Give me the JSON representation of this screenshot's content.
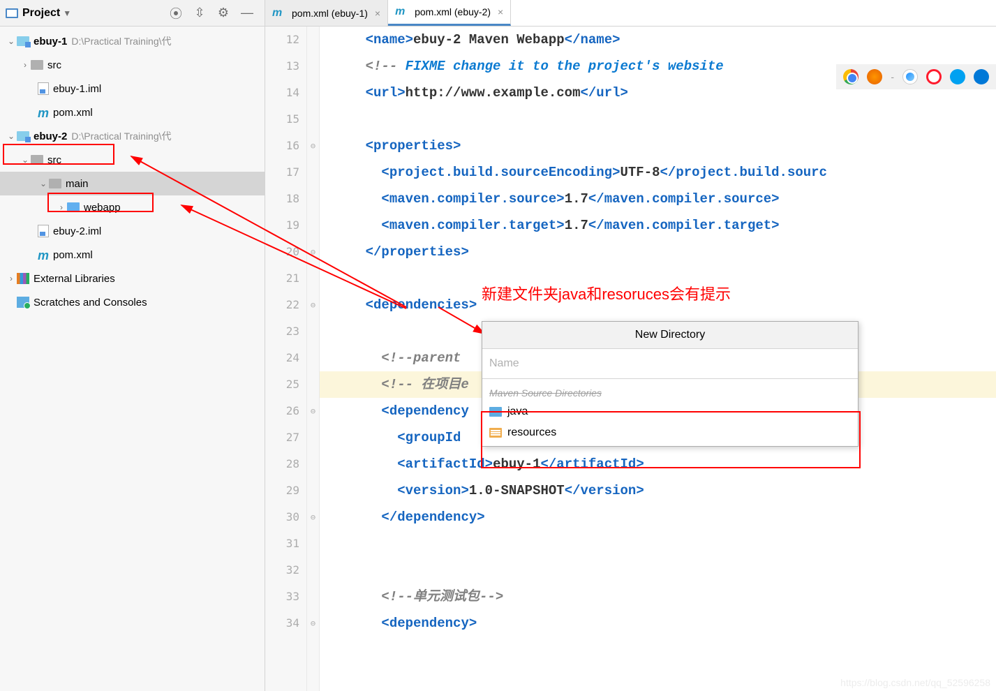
{
  "toolbar": {
    "title": "Project"
  },
  "tree": {
    "ebuy1": {
      "name": "ebuy-1",
      "path": "D:\\Practical Training\\代"
    },
    "ebuy1_src": "src",
    "ebuy1_iml": "ebuy-1.iml",
    "pom": "pom.xml",
    "ebuy2": {
      "name": "ebuy-2",
      "path": "D:\\Practical Training\\代"
    },
    "ebuy2_src": "src",
    "main": "main",
    "webapp": "webapp",
    "ebuy2_iml": "ebuy-2.iml",
    "external": "External Libraries",
    "scratches": "Scratches and Consoles"
  },
  "tabs": {
    "t1": "pom.xml (ebuy-1)",
    "t2": "pom.xml (ebuy-2)"
  },
  "code": {
    "l12": {
      "pre": "    ",
      "name_open": "name",
      "txt": "ebuy-2 Maven Webapp",
      "name_close": "name"
    },
    "l13": {
      "pre": "    ",
      "cmt_open": "<!-- ",
      "fixme": "FIXME change it to the project's website"
    },
    "l14": {
      "pre": "    ",
      "url_open": "url",
      "txt": "http://www.example.com",
      "url_close": "url"
    },
    "l16": {
      "pre": "    ",
      "prop": "properties"
    },
    "l17": {
      "pre": "      ",
      "tag": "project.build.sourceEncoding",
      "txt": "UTF-8"
    },
    "l18": {
      "pre": "      ",
      "tag": "maven.compiler.source",
      "txt": "1.7"
    },
    "l19": {
      "pre": "      ",
      "tag": "maven.compiler.target",
      "txt": "1.7"
    },
    "l20": {
      "pre": "    ",
      "prop": "properties"
    },
    "l22": {
      "pre": "    ",
      "dep": "dependencies"
    },
    "l24": {
      "pre": "      ",
      "cmt": "<!--parent"
    },
    "l25": {
      "pre": "      ",
      "cmt": "<!-- 在项目e"
    },
    "l26": {
      "pre": "      ",
      "dep": "dependency"
    },
    "l27": {
      "pre": "        ",
      "tag": "groupId"
    },
    "l28": {
      "pre": "        ",
      "open": "artifactId",
      "txt": "ebuy-1",
      "close": "artifactId"
    },
    "l29": {
      "pre": "        ",
      "tag": "version",
      "txt": "1.0-SNAPSHOT"
    },
    "l30": {
      "pre": "      ",
      "dep": "dependency"
    },
    "l33": {
      "pre": "      ",
      "cmt": "<!--单元测试包-->"
    },
    "l34": {
      "pre": "      ",
      "dep": "dependency"
    }
  },
  "lines": [
    "12",
    "13",
    "14",
    "15",
    "16",
    "17",
    "18",
    "19",
    "20",
    "21",
    "22",
    "23",
    "24",
    "25",
    "26",
    "27",
    "28",
    "29",
    "30",
    "31",
    "32",
    "33",
    "34"
  ],
  "annotation": "新建文件夹java和resoruces会有提示",
  "popup": {
    "title": "New Directory",
    "placeholder": "Name",
    "section": "Maven Source Directories",
    "item1": "java",
    "item2": "resources"
  },
  "watermark": "https://blog.csdn.net/qq_52596258"
}
